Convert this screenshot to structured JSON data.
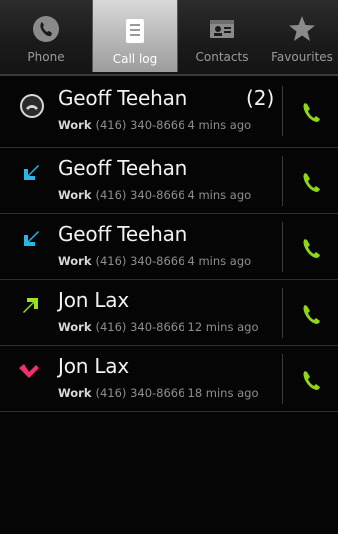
{
  "tabs": [
    {
      "label": "Phone",
      "icon": "phone-icon",
      "selected": false
    },
    {
      "label": "Call log",
      "icon": "call-log-icon",
      "selected": true
    },
    {
      "label": "Contacts",
      "icon": "contacts-icon",
      "selected": false
    },
    {
      "label": "Favourites",
      "icon": "star-icon",
      "selected": false
    }
  ],
  "calls": [
    {
      "name": "Geoff Teehan",
      "count": "(2)",
      "label": "Work",
      "number": "(416) 340-8666",
      "time": "4 mins ago",
      "type": "missed",
      "type_icon": "missed-call-icon"
    },
    {
      "name": "Geoff Teehan",
      "count": "",
      "label": "Work",
      "number": "(416) 340-8666",
      "time": "4 mins ago",
      "type": "incoming",
      "type_icon": "incoming-call-icon"
    },
    {
      "name": "Geoff Teehan",
      "count": "",
      "label": "Work",
      "number": "(416) 340-8666",
      "time": "4 mins ago",
      "type": "incoming",
      "type_icon": "incoming-call-icon"
    },
    {
      "name": "Jon Lax",
      "count": "",
      "label": "Work",
      "number": "(416) 340-8666",
      "time": "12 mins ago",
      "type": "outgoing",
      "type_icon": "outgoing-call-icon"
    },
    {
      "name": "Jon Lax",
      "count": "",
      "label": "Work",
      "number": "(416) 340-8666",
      "time": "18 mins ago",
      "type": "missed",
      "type_icon": "missed-call-red-icon"
    }
  ],
  "colors": {
    "incoming": "#29b6e6",
    "outgoing": "#9be21a",
    "missed": "#f0306a",
    "call_button": "#8fd61a"
  }
}
